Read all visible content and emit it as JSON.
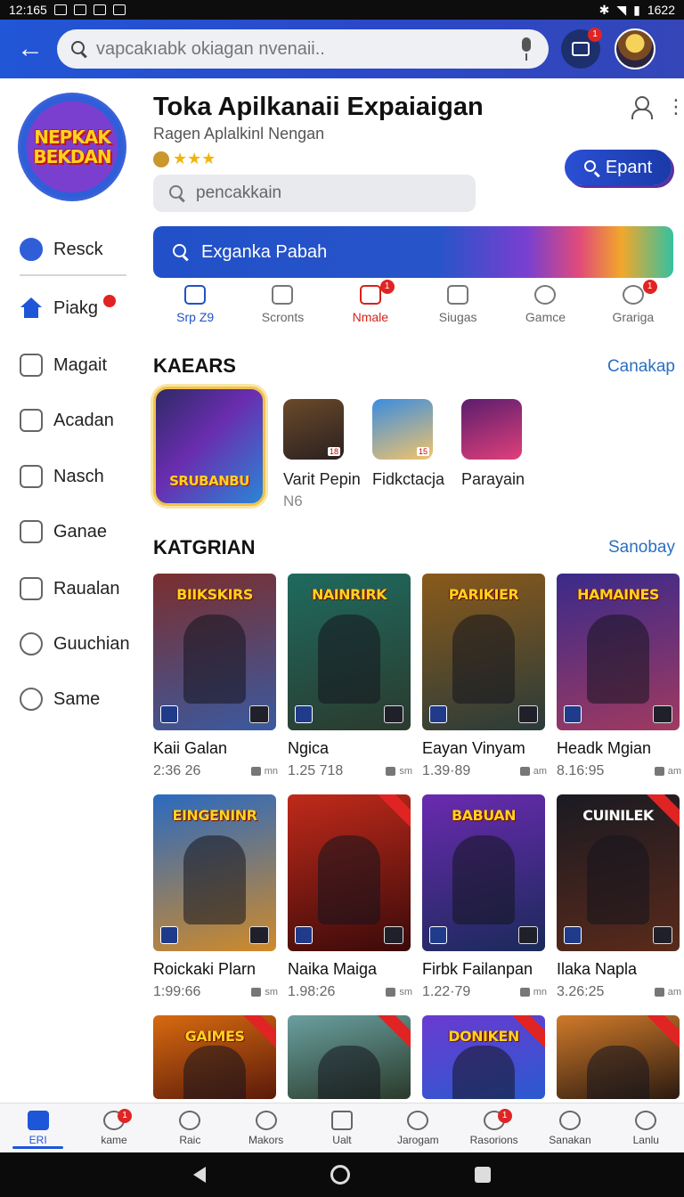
{
  "status": {
    "time": "12:165",
    "battery": "1622"
  },
  "search": {
    "placeholder": "vapcakıabk okiagan nvenaii.."
  },
  "top": {
    "notification_count": "1"
  },
  "sidebar": {
    "logo_line1": "NEPKAK",
    "logo_line2": "BEKDAN",
    "items": [
      {
        "label": "Resck",
        "icon": "refresh-icon"
      },
      {
        "label": "Piakg",
        "icon": "home-icon"
      },
      {
        "label": "Magait",
        "icon": "user-group-icon"
      },
      {
        "label": "Acadan",
        "icon": "cards-icon"
      },
      {
        "label": "Nasch",
        "icon": "window-icon"
      },
      {
        "label": "Ganae",
        "icon": "game-icon"
      },
      {
        "label": "Raualan",
        "icon": "frame-icon"
      },
      {
        "label": "Guuchian",
        "icon": "chat-icon"
      },
      {
        "label": "Same",
        "icon": "location-icon"
      }
    ]
  },
  "app": {
    "title": "Toka Apilkanaii Expaiaigan",
    "subtitle": "Ragen Aplalkinl Nengan",
    "stars": "★★★",
    "install_label": "Epant",
    "search_placeholder": "pencakkain",
    "banner_text": "Exganka Pabah"
  },
  "tabs": [
    {
      "label": "Srp Z9",
      "state": "active"
    },
    {
      "label": "Scronts",
      "state": ""
    },
    {
      "label": "Nmale",
      "state": "red",
      "badge": "1"
    },
    {
      "label": "Siugas",
      "state": ""
    },
    {
      "label": "Gamce",
      "state": ""
    },
    {
      "label": "Grariga",
      "state": "",
      "badge": "1"
    }
  ],
  "section1": {
    "title": "KAEARS",
    "link": "Canakap",
    "featured_title": "SRUBANBU",
    "apps": [
      {
        "name": "Varit Pepin",
        "meta": "N6",
        "badge": "18",
        "color1": "#6b4a2a",
        "color2": "#2a2020"
      },
      {
        "name": "Fidkctacja",
        "meta": "",
        "badge": "15",
        "color1": "#3a8de0",
        "color2": "#f2c36b"
      },
      {
        "name": "Parayain",
        "meta": "",
        "badge": "",
        "color1": "#5a1d6e",
        "color2": "#e0407a"
      }
    ]
  },
  "section2": {
    "title": "KATGRIAN",
    "link": "Sanobay",
    "games": [
      {
        "title": "BIIKSKIRS",
        "name": "Kaii Galan",
        "time": "2:36 26",
        "tag": "mn",
        "c1": "#7b2e2e",
        "c2": "#3a5aa0"
      },
      {
        "title": "NAINRIRK",
        "name": "Ngica",
        "time": "1.25 718",
        "tag": "sm",
        "c1": "#1f6a5e",
        "c2": "#2b3a2e"
      },
      {
        "title": "PARIKIER",
        "name": "Eayan Vinyam",
        "time": "1.39·89",
        "tag": "am",
        "c1": "#8a5a1a",
        "c2": "#2a3b3a"
      },
      {
        "title": "HAMAINES",
        "name": "Headk Mgian",
        "time": "8.16:95",
        "tag": "am",
        "c1": "#3a2a8a",
        "c2": "#a03a60"
      },
      {
        "title": "EINGENINR",
        "name": "Roickaki Plarn",
        "time": "1:99:66",
        "tag": "sm",
        "c1": "#2a6ac0",
        "c2": "#d08a2a"
      },
      {
        "title": "",
        "name": "Naika Maiga",
        "time": "1.98:26",
        "tag": "sm",
        "c1": "#c02a1a",
        "c2": "#3a0a0a"
      },
      {
        "title": "BABUAN",
        "name": "Firbk Failanpan",
        "time": "1.22·79",
        "tag": "mn",
        "c1": "#6a2ab0",
        "c2": "#1a2a5a"
      },
      {
        "title": "CUINILEK",
        "name": "Ilaka Napla",
        "time": "3.26:25",
        "tag": "am",
        "c1": "#1a1a22",
        "c2": "#5a2a1a"
      },
      {
        "title": "GAIMES",
        "name": "",
        "time": "",
        "tag": "",
        "c1": "#d86a10",
        "c2": "#5a1a0a"
      },
      {
        "title": "",
        "name": "",
        "time": "",
        "tag": "",
        "c1": "#6aa0a0",
        "c2": "#2a3a2a"
      },
      {
        "title": "DONIKEN",
        "name": "",
        "time": "",
        "tag": "",
        "c1": "#6a3ad0",
        "c2": "#2a5ad0"
      },
      {
        "title": "",
        "name": "",
        "time": "",
        "tag": "",
        "c1": "#d07a2a",
        "c2": "#2a1a10"
      }
    ]
  },
  "bottom_nav": [
    {
      "label": "ERI",
      "state": "active"
    },
    {
      "label": "kame",
      "badge": "1"
    },
    {
      "label": "Raic"
    },
    {
      "label": "Makors"
    },
    {
      "label": "Ualt"
    },
    {
      "label": "Jarogam"
    },
    {
      "label": "Rasorions",
      "badge": "1"
    },
    {
      "label": "Sanakan"
    },
    {
      "label": "Lanlu"
    }
  ]
}
